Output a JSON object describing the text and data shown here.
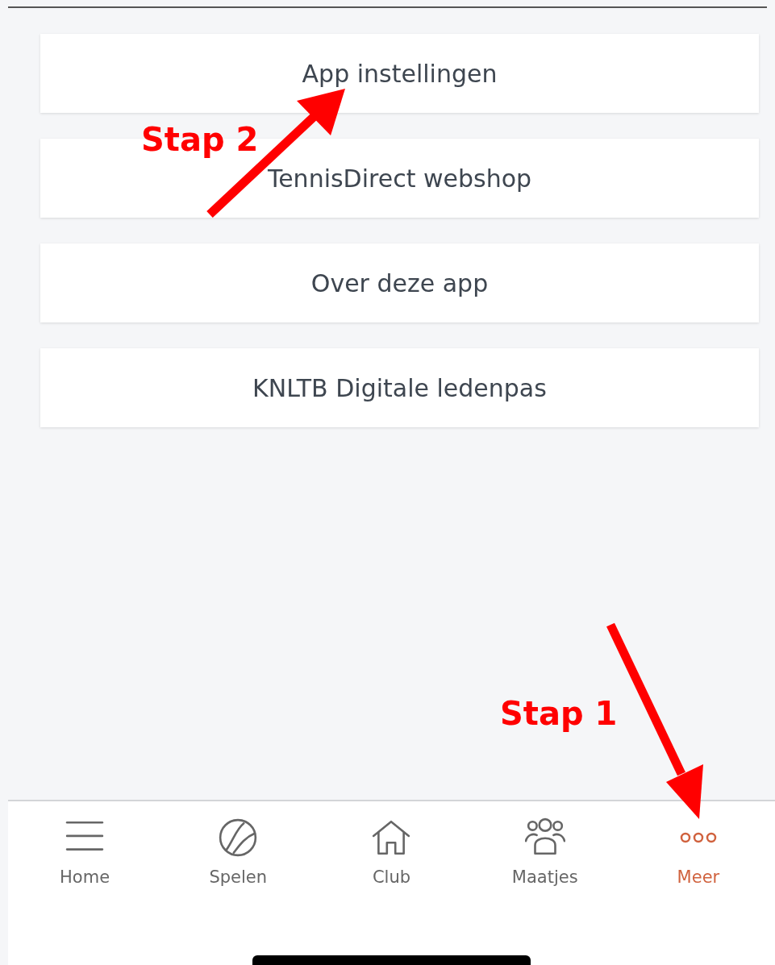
{
  "menu": [
    {
      "label": "App instellingen"
    },
    {
      "label": "TennisDirect webshop"
    },
    {
      "label": "Over deze app"
    },
    {
      "label": "KNLTB Digitale ledenpas"
    }
  ],
  "tabs": [
    {
      "label": "Home",
      "selected": false
    },
    {
      "label": "Spelen",
      "selected": false
    },
    {
      "label": "Club",
      "selected": false
    },
    {
      "label": "Maatjes",
      "selected": false
    },
    {
      "label": "Meer",
      "selected": true
    }
  ],
  "annotations": [
    {
      "label": "Stap 2"
    },
    {
      "label": "Stap 1"
    }
  ]
}
